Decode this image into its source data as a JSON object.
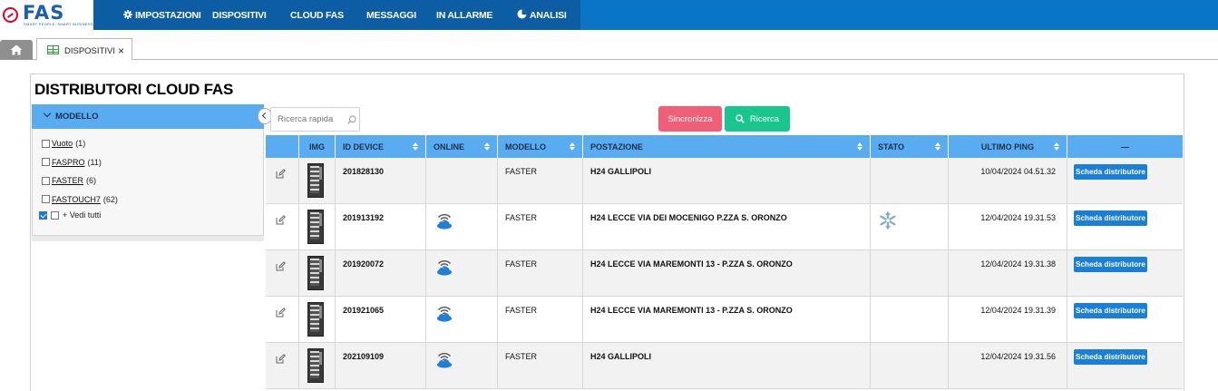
{
  "app": {
    "logo_text": "FAS",
    "logo_sub": "SMART PEOPLE. SMART BUSINESS."
  },
  "nav": {
    "items": [
      {
        "label": "IMPOSTAZIONI",
        "icon": "gear-icon"
      },
      {
        "label": "DISPOSITIVI"
      },
      {
        "label": "CLOUD FAS"
      },
      {
        "label": "MESSAGGI"
      },
      {
        "label": "IN ALLARME"
      },
      {
        "label": "ANALISI",
        "icon": "pie-chart-icon"
      }
    ]
  },
  "tabs": [
    {
      "name": "home",
      "icon": "home-icon"
    },
    {
      "label": "DISPOSITIVI",
      "icon": "grid-icon",
      "close": "×"
    }
  ],
  "page": {
    "title": "DISTRIBUTORI CLOUD FAS"
  },
  "filter": {
    "title": "MODELLO",
    "options": [
      {
        "label": "Vuoto",
        "count": "(1)"
      },
      {
        "label": "FASPRO",
        "count": "(11)"
      },
      {
        "label": "FASTER",
        "count": "(6)"
      },
      {
        "label": "FASTOUCH7",
        "count": "(62)"
      }
    ],
    "show_all": "+ Vedi tutti"
  },
  "toolbar": {
    "search_placeholder": "Ricerca rapida",
    "sync_label": "Sincronizza",
    "search_label": "Ricerca"
  },
  "table": {
    "columns": [
      "",
      "IMG",
      "ID DEVICE",
      "ONLINE",
      "MODELLO",
      "POSTAZIONE",
      "STATO",
      "ULTIMO PING",
      "—"
    ],
    "rows": [
      {
        "id": "201828130",
        "online": false,
        "modello": "FASTER",
        "postazione": "H24 GALLIPOLI",
        "stato": "",
        "ping": "10/04/2024 04.51.32",
        "action": "Scheda distributore"
      },
      {
        "id": "201913192",
        "online": true,
        "modello": "FASTER",
        "postazione": "H24 LECCE VIA DEI MOCENIGO P.ZZA S. ORONZO",
        "stato": "snowflake",
        "ping": "12/04/2024 19.31.53",
        "action": "Scheda distributore"
      },
      {
        "id": "201920072",
        "online": true,
        "modello": "FASTER",
        "postazione": "H24 LECCE VIA MAREMONTI 13 - P.ZZA S. ORONZO",
        "stato": "",
        "ping": "12/04/2024 19.31.38",
        "action": "Scheda distributore"
      },
      {
        "id": "201921065",
        "online": true,
        "modello": "FASTER",
        "postazione": "H24 LECCE VIA MAREMONTI 13 - P.ZZA S. ORONZO",
        "stato": "",
        "ping": "12/04/2024 19.31.39",
        "action": "Scheda distributore"
      },
      {
        "id": "202109109",
        "online": true,
        "modello": "FASTER",
        "postazione": "H24 GALLIPOLI",
        "stato": "",
        "ping": "12/04/2024 19.31.56",
        "action": "Scheda distributore"
      }
    ]
  },
  "colors": {
    "nav_blue": "#0a74c6",
    "header_blue": "#5aacf0",
    "sync_pink": "#f05e78",
    "search_green": "#19c78e",
    "button_blue": "#1a7fd6"
  }
}
